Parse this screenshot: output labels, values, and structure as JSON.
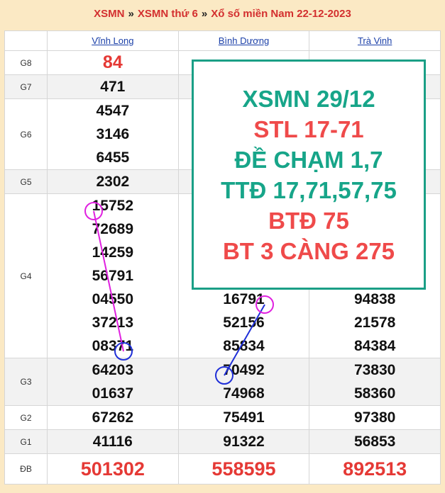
{
  "breadcrumb": {
    "home": "XSMN",
    "sep1": "»",
    "weekday": "XSMN thứ 6",
    "sep2": "»",
    "current": "Xổ số miền Nam 22-12-2023"
  },
  "table": {
    "columns": [
      "Vĩnh Long",
      "Bình Dương",
      "Trà Vinh"
    ],
    "prize_labels": {
      "g8": "G8",
      "g7": "G7",
      "g6": "G6",
      "g5": "G5",
      "g4": "G4",
      "g3": "G3",
      "g2": "G2",
      "g1": "G1",
      "db": "ĐB"
    },
    "vinh_long": {
      "g8": "84",
      "g7": "471",
      "g6": [
        "4547",
        "3146",
        "6455"
      ],
      "g5": "2302",
      "g4": [
        "15752",
        "72689",
        "14259",
        "56791",
        "04550",
        "37213",
        "08371"
      ],
      "g3": [
        "64203",
        "01637"
      ],
      "g2": "67262",
      "g1": "41116",
      "db": "501302"
    },
    "binh_duong": {
      "g4_visible": [
        "16791",
        "52156",
        "85834"
      ],
      "g3": [
        "70492",
        "74968"
      ],
      "g2": "75491",
      "g1": "91322",
      "db": "558595"
    },
    "tra_vinh": {
      "g4_visible": [
        "94838",
        "21578",
        "84384"
      ],
      "g3": [
        "73830",
        "58360"
      ],
      "g2": "97380",
      "g1": "56853",
      "db": "892513"
    }
  },
  "overlay": {
    "line1": "XSMN 29/12",
    "line2": "STL 17-71",
    "line3": "ĐỀ CHẠM 1,7",
    "line4": "TTĐ 17,71,57,75",
    "line5": "BTĐ 75",
    "line6": "BT 3 CÀNG 275"
  },
  "colors": {
    "highlight_red": "#e53935",
    "teal": "#17a589",
    "link_blue": "#1a3fa8",
    "annotation_magenta": "#e020e0",
    "annotation_blue": "#1f2fd8"
  }
}
